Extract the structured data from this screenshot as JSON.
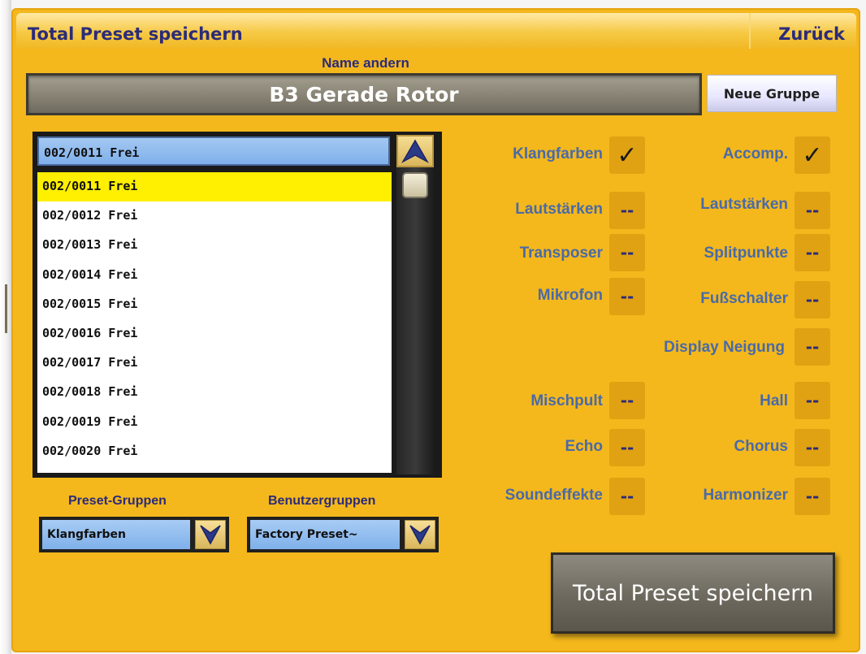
{
  "window": {
    "title": "Total Preset speichern",
    "back_label": "Zurück"
  },
  "name_section": {
    "label": "Name andern",
    "value": "B3 Gerade Rotor",
    "new_group_label": "Neue Gruppe"
  },
  "list": {
    "header_value": "002/0011 Frei",
    "items": [
      "002/0011 Frei",
      "002/0012 Frei",
      "002/0013 Frei",
      "002/0014 Frei",
      "002/0015 Frei",
      "002/0016 Frei",
      "002/0017 Frei",
      "002/0018 Frei",
      "002/0019 Frei",
      "002/0020 Frei"
    ],
    "selected_index": 0
  },
  "selectors": {
    "preset_groups": {
      "label": "Preset-Gruppen",
      "value": "Klangfarben"
    },
    "user_groups": {
      "label": "Benutzergruppen",
      "value": "Factory Preset~"
    }
  },
  "options": {
    "klangfarben": {
      "label": "Klangfarben",
      "state": "✓"
    },
    "accomp": {
      "label": "Accomp.",
      "state": "✓"
    },
    "lautstaerken_left": {
      "label": "Lautstärken",
      "state": "--"
    },
    "lautstaerken_right": {
      "label": "Lautstärken",
      "state": "--"
    },
    "transposer": {
      "label": "Transposer",
      "state": "--"
    },
    "splitpunkte": {
      "label": "Splitpunkte",
      "state": "--"
    },
    "mikrofon": {
      "label": "Mikrofon",
      "state": "--"
    },
    "fussschalter": {
      "label": "Fußschalter",
      "state": "--"
    },
    "display_neigung": {
      "label": "Display Neigung",
      "state": "--"
    },
    "mischpult": {
      "label": "Mischpult",
      "state": "--"
    },
    "hall": {
      "label": "Hall",
      "state": "--"
    },
    "echo": {
      "label": "Echo",
      "state": "--"
    },
    "chorus": {
      "label": "Chorus",
      "state": "--"
    },
    "soundeffekte": {
      "label": "Soundeffekte",
      "state": "--"
    },
    "harmonizer": {
      "label": "Harmonizer",
      "state": "--"
    }
  },
  "save_button_label": "Total Preset speichern",
  "colors": {
    "panel": "#f4b81c",
    "label_blue": "#4a6aa8",
    "title_navy": "#2b2b7a",
    "selection_yellow": "#ffef00"
  },
  "icons": {
    "scroll_up": "arrow-up-icon",
    "dropdown": "chevron-down-icon",
    "check": "checkmark-icon"
  }
}
